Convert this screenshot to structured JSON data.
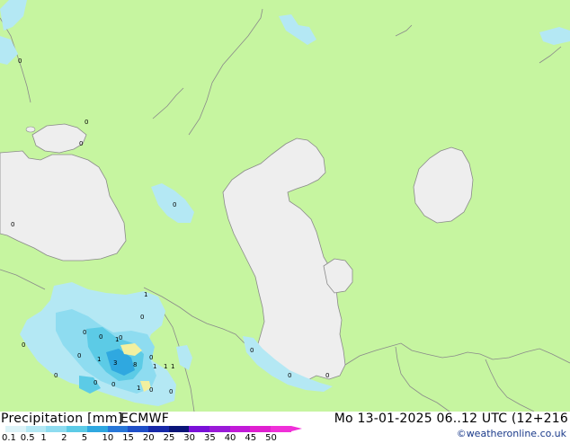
{
  "footer": {
    "title_left": "Precipitation [mm]",
    "model": "ECMWF",
    "valid_time": "Mo 13-01-2025 06..12 UTC (12+216",
    "credit": "©weatheronline.co.uk"
  },
  "legend": {
    "ticks": [
      "0.1",
      "0.5",
      "1",
      "2",
      "5",
      "10",
      "15",
      "20",
      "25",
      "30",
      "35",
      "40",
      "45",
      "50"
    ],
    "colors": [
      "#dcf3f8",
      "#b4e8f4",
      "#8edcf0",
      "#5ccbe6",
      "#2fa8e0",
      "#2877d8",
      "#1f4fc8",
      "#1628a8",
      "#0a1478",
      "#7a10d8",
      "#9a1ad8",
      "#c21ad8",
      "#e020d0",
      "#f030d8"
    ]
  },
  "map": {
    "land_color": "#c6f5a0",
    "sea_color": "#eeeeee",
    "value_labels": [
      "0",
      "0",
      "0",
      "0",
      "0",
      "1",
      "0",
      "0",
      "0",
      "1",
      "0",
      "0",
      "1",
      "0",
      "1",
      "0",
      "3",
      "8",
      "1",
      "1",
      "1",
      "0",
      "0",
      "0",
      "0",
      "0",
      "0",
      "0",
      "0"
    ]
  }
}
